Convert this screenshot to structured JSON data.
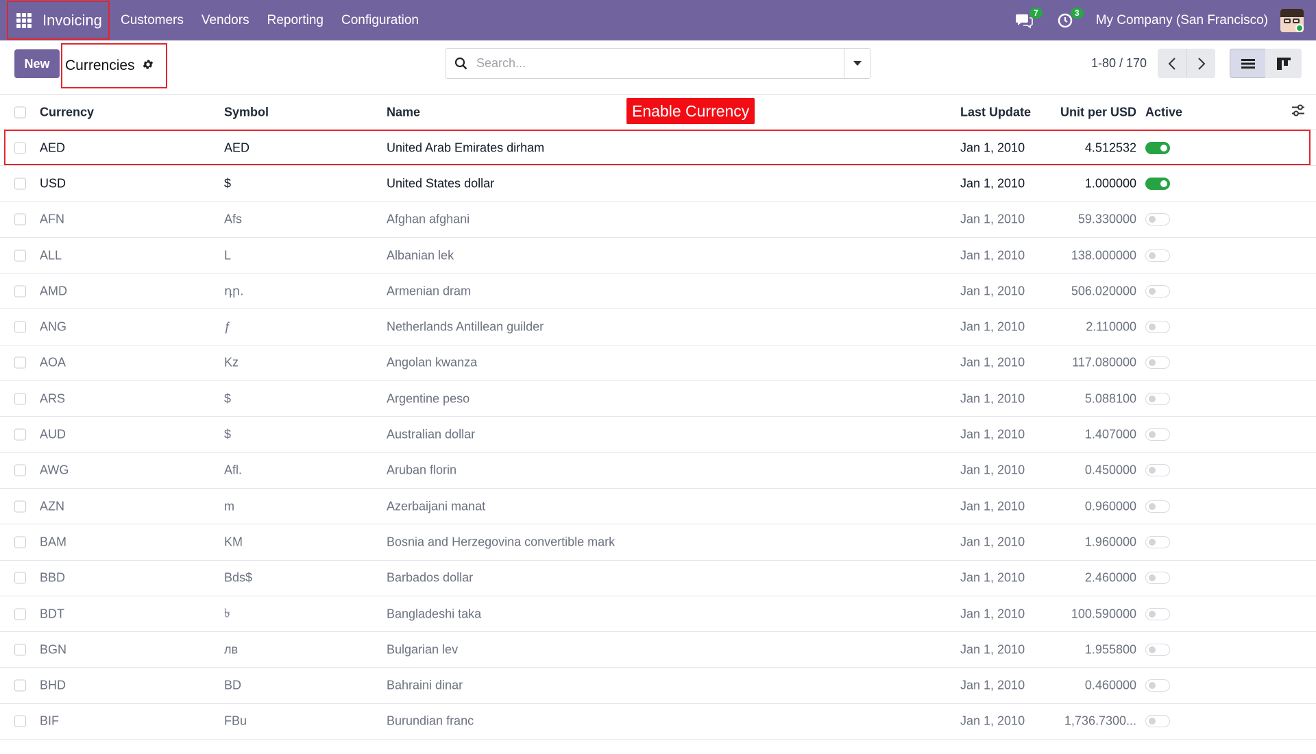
{
  "navbar": {
    "app_name": "Invoicing",
    "menu": [
      "Customers",
      "Vendors",
      "Reporting",
      "Configuration"
    ],
    "messages_count": "7",
    "activities_count": "3",
    "company": "My Company (San Francisco)"
  },
  "control": {
    "new_label": "New",
    "breadcrumb": "Currencies",
    "search_placeholder": "Search...",
    "pager": "1-80 / 170"
  },
  "annotation": "Enable Currency",
  "table": {
    "headers": {
      "currency": "Currency",
      "symbol": "Symbol",
      "name": "Name",
      "last_update": "Last Update",
      "rate": "Unit per USD",
      "active": "Active"
    },
    "rows": [
      {
        "code": "AED",
        "symbol": "AED",
        "name": "United Arab Emirates dirham",
        "date": "Jan 1, 2010",
        "rate": "4.512532",
        "active": true
      },
      {
        "code": "USD",
        "symbol": "$",
        "name": "United States dollar",
        "date": "Jan 1, 2010",
        "rate": "1.000000",
        "active": true
      },
      {
        "code": "AFN",
        "symbol": "Afs",
        "name": "Afghan afghani",
        "date": "Jan 1, 2010",
        "rate": "59.330000",
        "active": false
      },
      {
        "code": "ALL",
        "symbol": "L",
        "name": "Albanian lek",
        "date": "Jan 1, 2010",
        "rate": "138.000000",
        "active": false
      },
      {
        "code": "AMD",
        "symbol": "դր.",
        "name": "Armenian dram",
        "date": "Jan 1, 2010",
        "rate": "506.020000",
        "active": false
      },
      {
        "code": "ANG",
        "symbol": "ƒ",
        "name": "Netherlands Antillean guilder",
        "date": "Jan 1, 2010",
        "rate": "2.110000",
        "active": false
      },
      {
        "code": "AOA",
        "symbol": "Kz",
        "name": "Angolan kwanza",
        "date": "Jan 1, 2010",
        "rate": "117.080000",
        "active": false
      },
      {
        "code": "ARS",
        "symbol": "$",
        "name": "Argentine peso",
        "date": "Jan 1, 2010",
        "rate": "5.088100",
        "active": false
      },
      {
        "code": "AUD",
        "symbol": "$",
        "name": "Australian dollar",
        "date": "Jan 1, 2010",
        "rate": "1.407000",
        "active": false
      },
      {
        "code": "AWG",
        "symbol": "Afl.",
        "name": "Aruban florin",
        "date": "Jan 1, 2010",
        "rate": "0.450000",
        "active": false
      },
      {
        "code": "AZN",
        "symbol": "m",
        "name": "Azerbaijani manat",
        "date": "Jan 1, 2010",
        "rate": "0.960000",
        "active": false
      },
      {
        "code": "BAM",
        "symbol": "KM",
        "name": "Bosnia and Herzegovina convertible mark",
        "date": "Jan 1, 2010",
        "rate": "1.960000",
        "active": false
      },
      {
        "code": "BBD",
        "symbol": "Bds$",
        "name": "Barbados dollar",
        "date": "Jan 1, 2010",
        "rate": "2.460000",
        "active": false
      },
      {
        "code": "BDT",
        "symbol": "৳",
        "name": "Bangladeshi taka",
        "date": "Jan 1, 2010",
        "rate": "100.590000",
        "active": false
      },
      {
        "code": "BGN",
        "symbol": "лв",
        "name": "Bulgarian lev",
        "date": "Jan 1, 2010",
        "rate": "1.955800",
        "active": false
      },
      {
        "code": "BHD",
        "symbol": "BD",
        "name": "Bahraini dinar",
        "date": "Jan 1, 2010",
        "rate": "0.460000",
        "active": false
      },
      {
        "code": "BIF",
        "symbol": "FBu",
        "name": "Burundian franc",
        "date": "Jan 1, 2010",
        "rate": "1,736.7300...",
        "active": false
      }
    ]
  }
}
